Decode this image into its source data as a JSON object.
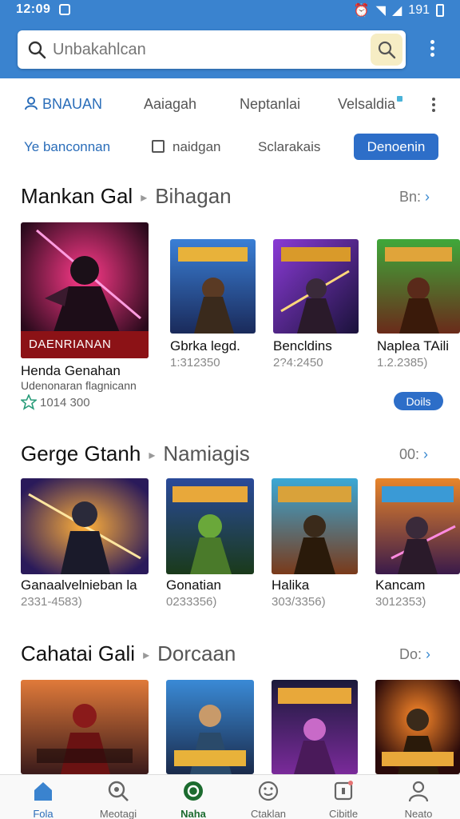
{
  "status": {
    "time": "12:09",
    "battery": "191"
  },
  "search": {
    "placeholder": "Unbakahlcan"
  },
  "tabs": [
    {
      "label": "BNAUAN",
      "active": true
    },
    {
      "label": "Aaiagah"
    },
    {
      "label": "Neptanlai"
    },
    {
      "label": "Velsaldia"
    }
  ],
  "filters": {
    "link": "Ye banconnan",
    "checkbox": "naidgan",
    "sort": "Sclarakais",
    "button": "Denoenin"
  },
  "sections": [
    {
      "title": "Mankan Gal",
      "sub": "Bihagan",
      "see_all": "Bn:",
      "items": [
        {
          "title": "Henda Genahan",
          "subtitle": "Udenonaran flagnicann",
          "banner": "DAENRIANAN",
          "rating": "1014 300"
        },
        {
          "title": "Gbrka legd.",
          "meta": "1:312350"
        },
        {
          "title": "Bencldins",
          "meta": "2?4:2450"
        },
        {
          "title": "Naplea TAili",
          "meta": "1.2.2385)"
        }
      ],
      "action": "Doils"
    },
    {
      "title": "Gerge Gtanh",
      "sub": "Namiagis",
      "see_all": "00:",
      "items": [
        {
          "title": "Ganaalvelnieban la",
          "meta": "2331-4583)"
        },
        {
          "title": "Gonatian",
          "meta": "0233356)"
        },
        {
          "title": "Halika",
          "meta": "303/3356)"
        },
        {
          "title": "Kancam",
          "meta": "3012353)"
        }
      ]
    },
    {
      "title": "Cahatai Gali",
      "sub": "Dorcaan",
      "see_all": "Do:",
      "items": [
        {
          "title": ""
        },
        {
          "title": ""
        },
        {
          "title": ""
        },
        {
          "title": ""
        }
      ]
    }
  ],
  "nav": [
    {
      "label": "Fola",
      "icon": "home-icon",
      "active": true
    },
    {
      "label": "Meotagi",
      "icon": "search-icon"
    },
    {
      "label": "Naha",
      "icon": "games-icon"
    },
    {
      "label": "Ctaklan",
      "icon": "smiley-icon"
    },
    {
      "label": "Cibitle",
      "icon": "box-icon"
    },
    {
      "label": "Neato",
      "icon": "person-icon"
    }
  ],
  "colors": {
    "accent": "#2d6ec8",
    "topbar": "#3a83cf",
    "banner": "#8c1216"
  }
}
